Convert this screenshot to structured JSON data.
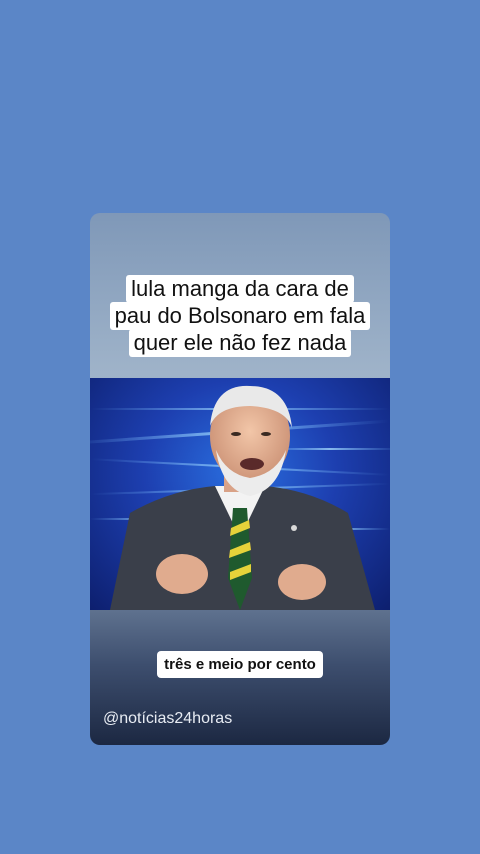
{
  "card": {
    "caption_lines": [
      "lula manga da cara de",
      "pau do Bolsonaro em fala",
      "quer ele não fez nada"
    ],
    "subtitle": "três e meio por cento",
    "handle": "@notícias24horas"
  },
  "colors": {
    "page_background": "#5b86c7",
    "caption_background": "#ffffff",
    "studio_blue": "#1d3fb0"
  }
}
